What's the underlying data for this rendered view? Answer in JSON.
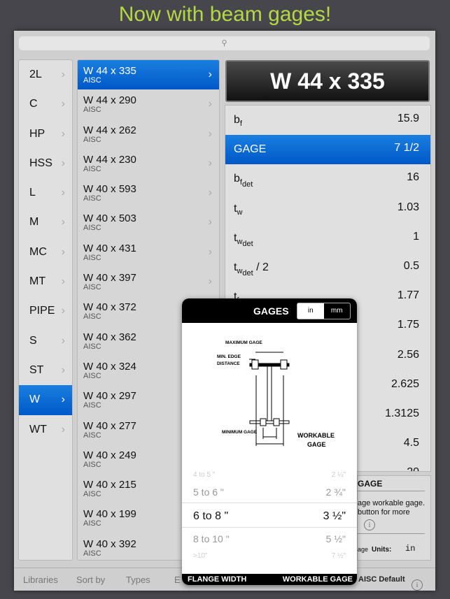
{
  "headline": "Now with beam gages!",
  "search": {
    "icon": "search-icon"
  },
  "types": [
    "2L",
    "C",
    "HP",
    "HSS",
    "L",
    "M",
    "MC",
    "MT",
    "PIPE",
    "S",
    "ST",
    "W",
    "WT"
  ],
  "selected_type": "W",
  "shapes": [
    {
      "name": "W 44 x 335",
      "lib": "AISC"
    },
    {
      "name": "W 44 x 290",
      "lib": "AISC"
    },
    {
      "name": "W 44 x 262",
      "lib": "AISC"
    },
    {
      "name": "W 44 x 230",
      "lib": "AISC"
    },
    {
      "name": "W 40 x 593",
      "lib": "AISC"
    },
    {
      "name": "W 40 x 503",
      "lib": "AISC"
    },
    {
      "name": "W 40 x 431",
      "lib": "AISC"
    },
    {
      "name": "W 40 x 397",
      "lib": "AISC"
    },
    {
      "name": "W 40 x 372",
      "lib": "AISC"
    },
    {
      "name": "W 40 x 362",
      "lib": "AISC"
    },
    {
      "name": "W 40 x 324",
      "lib": "AISC"
    },
    {
      "name": "W 40 x 297",
      "lib": "AISC"
    },
    {
      "name": "W 40 x 277",
      "lib": "AISC"
    },
    {
      "name": "W 40 x 249",
      "lib": "AISC"
    },
    {
      "name": "W 40 x 215",
      "lib": "AISC"
    },
    {
      "name": "W 40 x 199",
      "lib": "AISC"
    },
    {
      "name": "W 40 x 392",
      "lib": "AISC"
    }
  ],
  "title": "W 44 x 335",
  "properties": [
    {
      "l": "b",
      "sub": "f",
      "v": "15.9"
    },
    {
      "l": "GAGE",
      "sub": "",
      "v": "7 1/2",
      "selected": true
    },
    {
      "l": "b",
      "sub": "f",
      "sub2": "det",
      "v": "16"
    },
    {
      "l": "t",
      "sub": "w",
      "v": "1.03"
    },
    {
      "l": "t",
      "sub": "w",
      "sub2": "det",
      "v": "1"
    },
    {
      "l": "t",
      "sub": "w",
      "sub2": "det",
      "suffix": " / 2",
      "v": "0.5"
    },
    {
      "l": "t",
      "sub": "f",
      "v": "1.77"
    },
    {
      "l": "",
      "v": "1.75"
    },
    {
      "l": "",
      "v": "2.56"
    },
    {
      "l": "",
      "v": "2.625"
    },
    {
      "l": "",
      "v": "1.3125"
    },
    {
      "l": "",
      "v": "4.5"
    },
    {
      "l": "",
      "v": "20"
    }
  ],
  "info": {
    "heading": "GAGE",
    "line1": "age workable gage.",
    "line2": "button for more",
    "units_prefix": "age",
    "units_label": "Units:",
    "units_value": "in"
  },
  "bottom": {
    "libraries": "Libraries",
    "sort_by": "Sort by",
    "types": "Types",
    "partial": "E",
    "aisc_default": "AISC Default"
  },
  "popup": {
    "title": "GAGES",
    "unit_in": "in",
    "unit_mm": "mm",
    "selected_unit": "in",
    "diagram": {
      "max_gage": "MAXIMUM GAGE",
      "min_edge": "MIN. EDGE",
      "distance": "DISTANCE",
      "min_gage": "MINIMUM GAGE",
      "workable": "WORKABLE",
      "gage": "GAGE"
    },
    "rows": [
      {
        "w": "4 to 5 \"",
        "g": "2 ¼\""
      },
      {
        "w": "5 to 6 \"",
        "g": "2 ¾\""
      },
      {
        "w": "6 to 8 \"",
        "g": "3 ½\""
      },
      {
        "w": "8 to 10 \"",
        "g": "5 ½\""
      },
      {
        "w": ">10\"",
        "g": "7 ½\""
      }
    ],
    "selected_row": 2,
    "footer_left": "FLANGE WIDTH",
    "footer_right": "WORKABLE GAGE"
  },
  "colors": {
    "accent": "#0a6ad8",
    "headline": "#b4d843",
    "background": "#47464c"
  }
}
